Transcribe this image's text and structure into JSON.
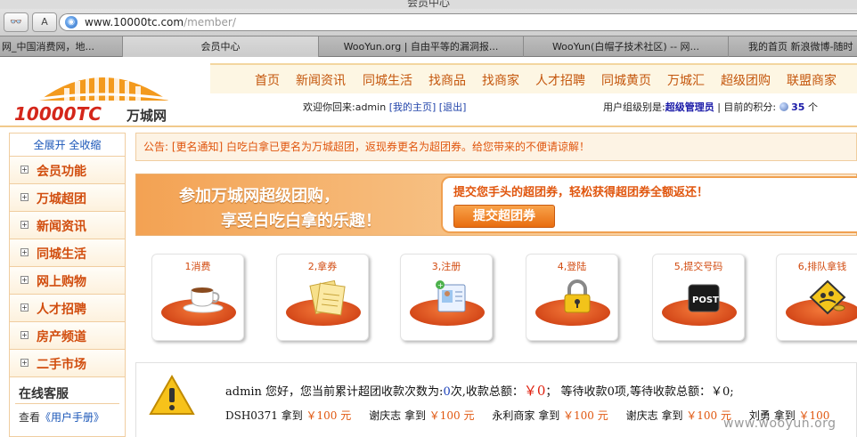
{
  "window": {
    "title": "会员中心"
  },
  "toolbar": {
    "reading_btn": "👓",
    "font_btn": "A"
  },
  "address": {
    "host": "www.10000tc.com",
    "path": "/member/"
  },
  "tabs": [
    {
      "label": "网_中国消费网，地..."
    },
    {
      "label": "会员中心"
    },
    {
      "label": "WooYun.org | 自由平等的漏洞报..."
    },
    {
      "label": "WooYun(白帽子技术社区) -- 网..."
    },
    {
      "label": "我的首页 新浪微博-随时"
    }
  ],
  "logo": {
    "text": "10000TC",
    "cn": "万城网"
  },
  "nav": [
    "首页",
    "新闻资讯",
    "同城生活",
    "找商品",
    "找商家",
    "人才招聘",
    "同城黄页",
    "万城汇",
    "超级团购",
    "联盟商家"
  ],
  "welcome": {
    "prefix": "欢迎你回来:admin",
    "home_link": "[我的主页]",
    "logout_link": "[退出]"
  },
  "userinfo": {
    "group_label": "用户组级别是:",
    "group": "超级管理员",
    "points_label": "| 目前的积分:",
    "points": "35",
    "unit": "个"
  },
  "sidebar": {
    "expand": "全展开",
    "collapse": "全收缩",
    "items": [
      "会员功能",
      "万城超团",
      "新闻资讯",
      "同城生活",
      "网上购物",
      "人才招聘",
      "房产频道",
      "二手市场"
    ],
    "kefu": "在线客服",
    "manual_prefix": "查看",
    "manual_link": "《用户手册》"
  },
  "notice": "公告: [更名通知] 白吃白拿已更名为万城超团，返现券更名为超团券。给您带来的不便请谅解！",
  "banner": {
    "line1": "参加万城网超级团购，",
    "line2": "享受白吃白拿的乐趣！",
    "slogan": "提交您手头的超团券，轻松获得超团券全额返还！",
    "submit": "提交超团券"
  },
  "steps": [
    {
      "label": "1消费",
      "icon": "coffee-cup-icon"
    },
    {
      "label": "2,拿券",
      "icon": "coupon-papers-icon"
    },
    {
      "label": "3,注册",
      "icon": "register-card-icon"
    },
    {
      "label": "4,登陆",
      "icon": "padlock-icon"
    },
    {
      "label": "5,提交号码",
      "icon": "post-icon"
    },
    {
      "label": "6,排队拿钱",
      "icon": "money-sign-icon"
    }
  ],
  "stats": {
    "greeting": "admin 您好，您当前累计超团收款次数为:",
    "count": "0",
    "count_suffix": "次,收款总额：",
    "total": "￥0",
    "pending_prefix": "； 等待收款",
    "pending_count": "0",
    "pending_suffix": "项,等待收款总额：",
    "pending_total": "￥0;"
  },
  "feed": [
    {
      "name": "DSH0371",
      "verb": "拿到",
      "amount": "￥100 元"
    },
    {
      "name": "谢庆志",
      "verb": "拿到",
      "amount": "￥100 元"
    },
    {
      "name": "永利商家",
      "verb": "拿到",
      "amount": "￥100 元"
    },
    {
      "name": "谢庆志",
      "verb": "拿到",
      "amount": "￥100 元"
    },
    {
      "name": "刘勇",
      "verb": "拿到",
      "amount": "￥100"
    }
  ],
  "watermark": "www.wooyun.org",
  "colors": {
    "accent_orange": "#e0560e",
    "nav_bg": "#fdf6e3",
    "link_blue": "#1a56b8"
  }
}
